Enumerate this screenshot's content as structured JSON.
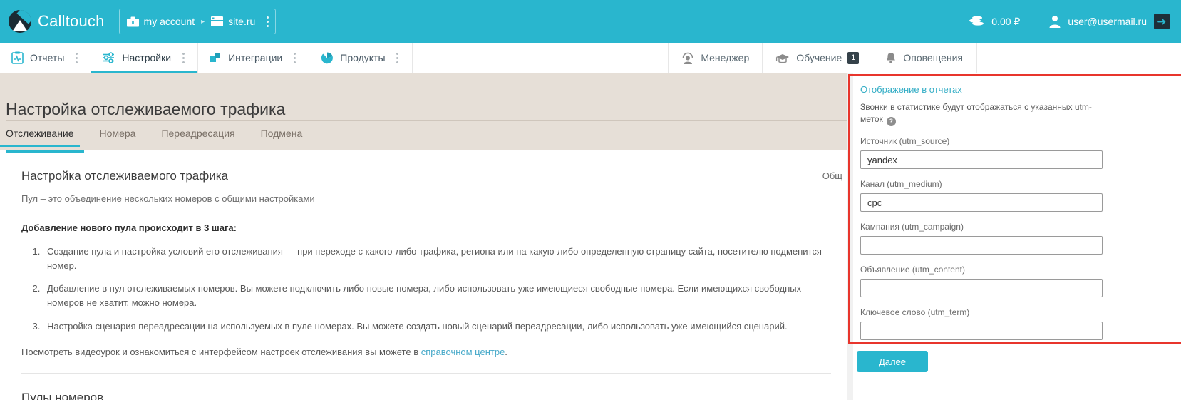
{
  "header": {
    "brand": "Calltouch",
    "logo_icon": "calltouch-logo-icon",
    "account": {
      "account_icon": "briefcase-icon",
      "account_label": "my account",
      "separator": "▸",
      "site_icon": "browser-window-icon",
      "site_label": "site.ru",
      "menu_icon": "kebab-menu-icon"
    },
    "balance": {
      "icon": "coins-icon",
      "value": "0.00 ₽"
    },
    "user": {
      "icon": "user-avatar-icon",
      "email": "user@usermail.ru",
      "logout_icon": "logout-arrow-icon"
    }
  },
  "nav": {
    "items": [
      {
        "label": "Отчеты",
        "icon": "reports-clipboard-icon",
        "active": false
      },
      {
        "label": "Настройки",
        "icon": "settings-sliders-icon",
        "active": true
      },
      {
        "label": "Интеграции",
        "icon": "integrations-squares-icon",
        "active": false
      },
      {
        "label": "Продукты",
        "icon": "products-pie-icon",
        "active": false
      }
    ],
    "right_items": [
      {
        "label": "Менеджер",
        "icon": "manager-headset-icon",
        "badge": ""
      },
      {
        "label": "Обучение",
        "icon": "graduation-cap-icon",
        "badge": "1"
      },
      {
        "label": "Оповещения",
        "icon": "bell-icon",
        "badge": ""
      }
    ]
  },
  "page": {
    "title": "Настройка отслеживаемого трафика",
    "tabs": [
      {
        "label": "Отслеживание",
        "active": true
      },
      {
        "label": "Номера",
        "active": false
      },
      {
        "label": "Переадресация",
        "active": false
      },
      {
        "label": "Подмена",
        "active": false
      }
    ]
  },
  "card": {
    "heading": "Настройка отслеживаемого трафика",
    "subtitle": "Пул – это объединение нескольких номеров с общими настройками",
    "corner_label": "Общ",
    "steps_title": "Добавление нового пула происходит в 3 шага:",
    "steps": [
      "Создание пула и настройка условий его отслеживания — при переходе с какого-либо трафика, региона или на какую-либо определенную страницу сайта, посетителю подменится номер.",
      "Добавление в пул отслеживаемых номеров. Вы можете подключить либо новые номера, либо использовать уже имеющиеся свободные номера. Если имеющихся свободных номеров не хватит, можно номера.",
      "Настройка сценария переадресации на используемых в пуле номерах. Вы можете создать новый сценарий переадресации, либо использовать уже имеющийся сценарий."
    ],
    "video_text": "Посмотреть видеоурок и ознакомиться с интерфейсом настроек отслеживания вы можете в ",
    "video_link": "справочном центре",
    "video_tail": ".",
    "pools_heading": "Пулы номеров"
  },
  "side_panel": {
    "title": "Отображение в отчетах",
    "description": "Звонки в статистике будут отображаться с указанных utm-меток",
    "help_icon": "help-question-icon",
    "help_glyph": "?",
    "fields": [
      {
        "label": "Источник (utm_source)",
        "value": "yandex",
        "placeholder": "",
        "name": "utm-source-input"
      },
      {
        "label": "Канал (utm_medium)",
        "value": "cpc",
        "placeholder": "",
        "name": "utm-medium-input"
      },
      {
        "label": "Кампания (utm_campaign)",
        "value": "",
        "placeholder": "",
        "name": "utm-campaign-input"
      },
      {
        "label": "Объявление (utm_content)",
        "value": "",
        "placeholder": "",
        "name": "utm-content-input"
      },
      {
        "label": "Ключевое слово (utm_term)",
        "value": "",
        "placeholder": "",
        "name": "utm-term-input"
      }
    ],
    "next_button": "Далее",
    "highlight_color": "#e8352c"
  },
  "colors": {
    "brand": "#29b6ce",
    "title_strip": "#e6dfd7",
    "link": "#46a9c9",
    "highlight": "#e8352c"
  }
}
